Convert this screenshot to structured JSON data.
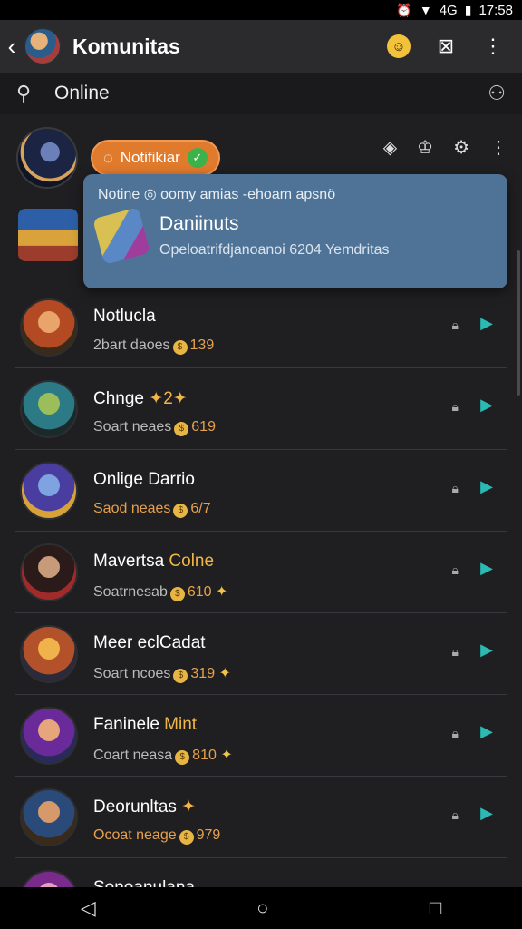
{
  "status": {
    "time": "17:58",
    "network": "4G"
  },
  "appbar": {
    "title": "Komunitas"
  },
  "search": {
    "query": "Online"
  },
  "top": {
    "notif_label": "Notifikiar",
    "popup": {
      "header": "Notine ◎ oomy amias -ehoam apsnö",
      "title": "Daniinuts",
      "desc": "Opeloatrifdjanoanoi 6204 Yemdritas"
    }
  },
  "items": [
    {
      "title": "Notlucla",
      "title_accent": "",
      "sub": "2bart daoes",
      "num": "139",
      "star": ""
    },
    {
      "title": "Chnge ",
      "title_accent": "✦2✦",
      "sub": "Soart neaes",
      "num": "619",
      "star": ""
    },
    {
      "title": "Onlige Darrio",
      "title_accent": "",
      "sub": "Saod neaes",
      "num": "6/7",
      "star": ""
    },
    {
      "title": "Mavertsa ",
      "title_accent": "Colne",
      "sub": "Soatrnesab",
      "num": "610",
      "star": "✦"
    },
    {
      "title": "Meer eclCadat",
      "title_accent": "",
      "sub": "Soart ncoes",
      "num": "319",
      "star": "✦"
    },
    {
      "title": "Faninele ",
      "title_accent": "Mint",
      "sub": "Coart neasa",
      "num": "810",
      "star": "✦"
    },
    {
      "title": "Deorunltas ",
      "title_accent": "✦",
      "sub": "Ocoat neage",
      "num": "979",
      "star": ""
    },
    {
      "title": "Sonoanulana",
      "title_accent": "",
      "sub": "",
      "num": "",
      "star": ""
    }
  ]
}
